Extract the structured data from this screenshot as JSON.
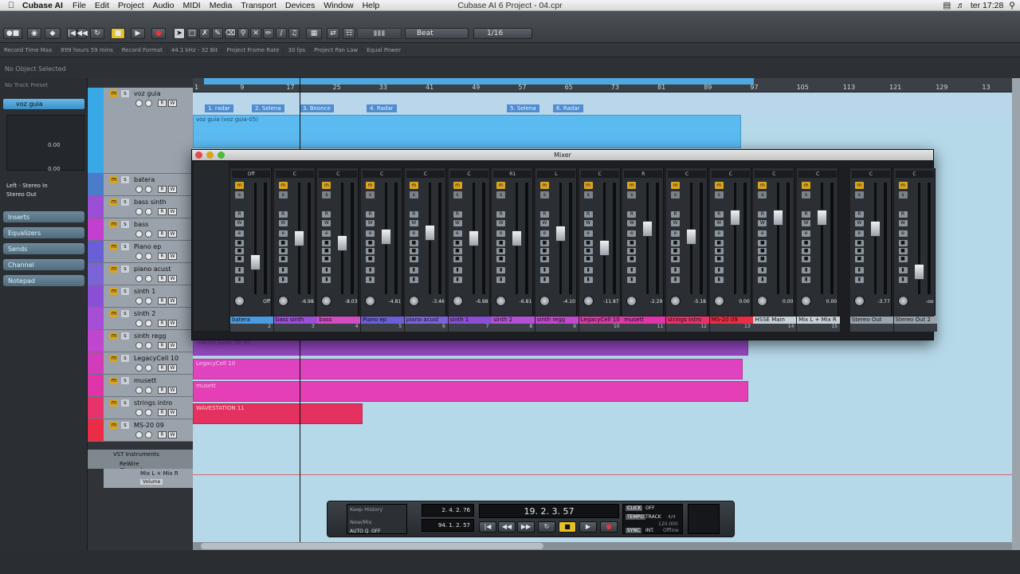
{
  "menubar": {
    "app": "Cubase AI",
    "items": [
      "File",
      "Edit",
      "Project",
      "Audio",
      "MIDI",
      "Media",
      "Transport",
      "Devices",
      "Window",
      "Help"
    ],
    "window_title": "Cubase AI 6 Project - 04.cpr",
    "clock": "ter 17:28"
  },
  "toolbar": {
    "snap_type": "Beat",
    "quantize": "1/16"
  },
  "infoline": {
    "items": [
      "Record Time Max",
      "899 hours 59 mins",
      "Record Format",
      "44.1 kHz - 32 Bit",
      "Project Frame Rate",
      "30 fps",
      "Project Pan Law",
      "Equal Power"
    ]
  },
  "objline": "No Object Selected",
  "inspector": {
    "preset": "No Track Preset",
    "track_name": "voz guia",
    "value1": "0.00",
    "value2": "0.00",
    "routing_in": "Left - Stereo In",
    "routing_out": "Stereo Out",
    "sections": [
      "Inserts",
      "Equalizers",
      "Sends",
      "Channel",
      "Notepad"
    ]
  },
  "tracks": [
    {
      "name": "voz guia",
      "color": "#39a8e6",
      "height": 110
    },
    {
      "name": "batera",
      "color": "#4a7cc9",
      "height": 28
    },
    {
      "name": "bass sinth",
      "color": "#9b4fd6",
      "height": 28
    },
    {
      "name": "bass",
      "color": "#c23fd0",
      "height": 28
    },
    {
      "name": "Piano ep",
      "color": "#6a5fd6",
      "height": 28
    },
    {
      "name": "piano acust",
      "color": "#7b63d8",
      "height": 28
    },
    {
      "name": "sinth 1",
      "color": "#8b4fd6",
      "height": 28
    },
    {
      "name": "sinth 2",
      "color": "#a64fd6",
      "height": 28
    },
    {
      "name": "sinth regg",
      "color": "#bf47cf",
      "height": 28
    },
    {
      "name": "LegacyCell 10",
      "color": "#d13cba",
      "height": 28
    },
    {
      "name": "musett",
      "color": "#e034ab",
      "height": 28
    },
    {
      "name": "strings intro",
      "color": "#e8326b",
      "height": 28
    },
    {
      "name": "MS-20 09",
      "color": "#e82d45",
      "height": 28
    }
  ],
  "folders": [
    "VST Instruments",
    "ReWire Channels"
  ],
  "rewire_track": {
    "name": "Mix L + Mix R",
    "param": "Volume"
  },
  "ruler_ticks": [
    "1",
    "9",
    "17",
    "25",
    "33",
    "41",
    "49",
    "57",
    "65",
    "73",
    "81",
    "89",
    "97",
    "105",
    "113",
    "121",
    "129",
    "13"
  ],
  "markers": [
    "1. radar",
    "2. Selena",
    "3. Beonce",
    "4. Radar",
    "5. Selena",
    "6. Radar"
  ],
  "parts": [
    {
      "label": "voz guia (voz guia-05)"
    },
    {
      "label": "HALion Sonic SE 05"
    },
    {
      "label": "LegacyCell 10"
    },
    {
      "label": "musett"
    },
    {
      "label": "WAVESTATION 11"
    }
  ],
  "mixer": {
    "title": "Mixer",
    "channels": [
      {
        "name": "batera",
        "num": "2",
        "vol": "Off",
        "top": "Off",
        "color": "#4a9be0",
        "fader": 0.25
      },
      {
        "name": "bass sinth",
        "num": "3",
        "vol": "-6.98",
        "top": "C",
        "color": "#9b4fd6",
        "fader": 0.5
      },
      {
        "name": "bass",
        "num": "4",
        "vol": "-8.03",
        "top": "C",
        "color": "#d34cc4",
        "fader": 0.45
      },
      {
        "name": "Piano ep",
        "num": "5",
        "vol": "-4.81",
        "top": "C",
        "color": "#6a5fd6",
        "fader": 0.52
      },
      {
        "name": "piano acust",
        "num": "6",
        "vol": "-3.46",
        "top": "C",
        "color": "#7b63d8",
        "fader": 0.56
      },
      {
        "name": "sinth 1",
        "num": "7",
        "vol": "-6.98",
        "top": "C",
        "color": "#8b4fd6",
        "fader": 0.5
      },
      {
        "name": "sinth 2",
        "num": "8",
        "vol": "-6.81",
        "top": "R1",
        "color": "#b54fd6",
        "fader": 0.5
      },
      {
        "name": "sinth regg",
        "num": "9",
        "vol": "-4.10",
        "top": "L",
        "color": "#c447cf",
        "fader": 0.55
      },
      {
        "name": "LegacyCell 10",
        "num": "10",
        "vol": "-11.87",
        "top": "C",
        "color": "#d83ca8",
        "fader": 0.4
      },
      {
        "name": "musett",
        "num": "11",
        "vol": "-2.29",
        "top": "R",
        "color": "#e034ab",
        "fader": 0.6
      },
      {
        "name": "strings intro",
        "num": "12",
        "vol": "-5.18",
        "top": "C",
        "color": "#e8326b",
        "fader": 0.52
      },
      {
        "name": "MS-20 09",
        "num": "13",
        "vol": "0.00",
        "top": "C",
        "color": "#e82d45",
        "fader": 0.72
      },
      {
        "name": "HSSE Main",
        "num": "14",
        "vol": "0.00",
        "top": "C",
        "color": "#c8d0d8",
        "fader": 0.72
      },
      {
        "name": "Mix L + Mix R",
        "num": "15",
        "vol": "0.00",
        "top": "C",
        "color": "#c8d0d8",
        "fader": 0.72
      },
      {
        "name": "Stereo Out",
        "num": "",
        "vol": "-3.77",
        "top": "C",
        "color": "#9aa4ae",
        "fader": 0.6
      },
      {
        "name": "Stereo Out 2",
        "num": "",
        "vol": "-oo",
        "top": "C",
        "color": "#9aa4ae",
        "fader": 0.15
      }
    ]
  },
  "transport": {
    "keep_history": "Keep History",
    "new_mix": "New/Mix",
    "auto_q": "AUTO Q",
    "auto_q_state": "OFF",
    "left_locator": "2. 4. 2. 76",
    "right_locator": "94. 1. 2. 57",
    "position": "19. 2. 3. 57",
    "click": "CLICK",
    "click_state": "OFF",
    "tempo": "TEMPO",
    "tempo_state": "TRACK",
    "signature": "4/4",
    "bpm": "120.000",
    "sync": "SYNC",
    "sync_state": "INT.",
    "sync_mode": "Offline"
  }
}
